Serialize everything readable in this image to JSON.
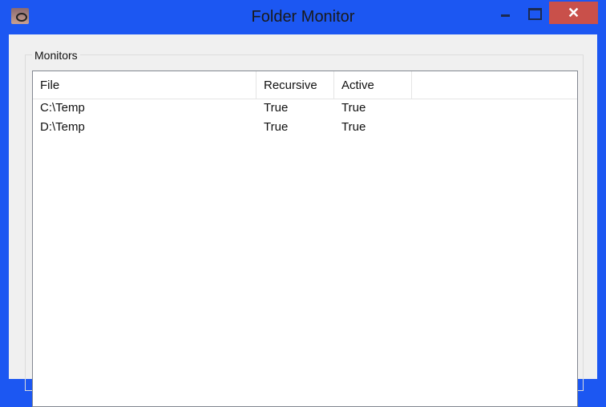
{
  "window": {
    "title": "Folder Monitor",
    "close_glyph": "✕"
  },
  "monitors": {
    "group_label": "Monitors",
    "columns": [
      "File",
      "Recursive",
      "Active"
    ],
    "rows": [
      {
        "file": "C:\\Temp",
        "recursive": "True",
        "active": "True"
      },
      {
        "file": "D:\\Temp",
        "recursive": "True",
        "active": "True"
      }
    ]
  }
}
